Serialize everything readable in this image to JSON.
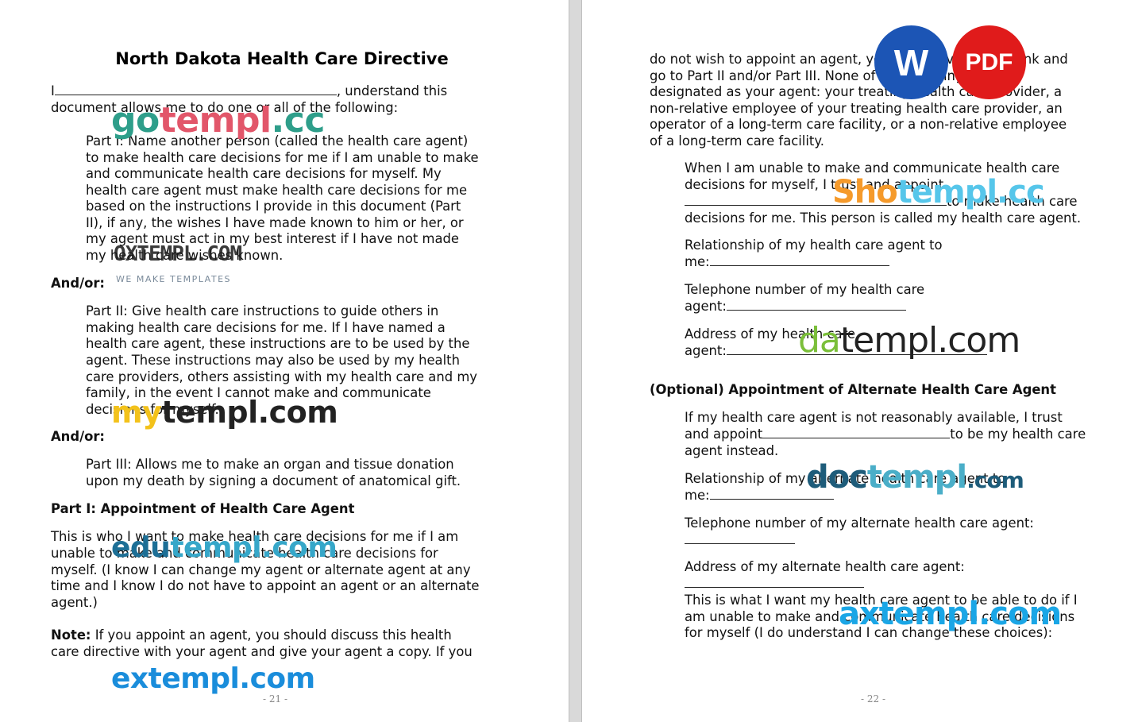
{
  "left_page": {
    "title": "North Dakota Health Care Directive",
    "intro_line1_prefix": "I",
    "intro_line1_suffix": ", understand this",
    "intro_line2": "document allows me to do one or all of the following:",
    "part1_lines": [
      "Part I: Name another person (called the health care agent)",
      "to make health care decisions for me if I am unable to make",
      "and communicate health care decisions for myself. My",
      "health care agent must make health care decisions for me",
      "based on the instructions I provide in this document (Part",
      "II), if any, the wishes I have made known to him or her, or",
      "my agent must act in my best interest if I have not made",
      "my health care wishes known."
    ],
    "and_or_1": "And/or:",
    "part2_lines": [
      "Part II: Give health care instructions to guide others in",
      "making health care decisions for me. If I have named a",
      "health care agent, these instructions are to be used by the",
      "agent. These instructions may also be used by my health",
      "care providers, others assisting with my health care and my",
      "family, in the event I cannot make and communicate",
      "decisions for myself."
    ],
    "and_or_2": "And/or:",
    "part3_lines": [
      "Part III: Allows me to make an organ and tissue donation",
      "upon my death by signing a document of anatomical gift."
    ],
    "heading_part1": "Part I: Appointment of Health Care Agent",
    "agent_lines": [
      "This is who I want to make health care decisions for me if I am",
      "unable to make and communicate health care decisions for",
      "myself. (I know I can change my agent or alternate agent at any",
      "time and I know I do not have to appoint an agent or an alternate",
      "agent.)"
    ],
    "note_label": "Note:",
    "note_line1_rest": " If you appoint an agent, you should discuss this health",
    "note_line2": "care directive with your agent and give your agent a copy. If you",
    "page_number": "- 21 -"
  },
  "right_page": {
    "top_lines": [
      "do not wish to appoint an agent, you may leave Part I blank and",
      "go to Part II and/or Part III. None of the following may be",
      "designated as your agent: your treating health care provider, a",
      "non-relative employee of your treating health care provider, an",
      "operator of a long-term care facility, or a non-relative employee",
      "of a long-term care facility."
    ],
    "appoint_line1": "When I am unable to make and communicate health care",
    "appoint_line2": "decisions for myself, I trust and appoint",
    "appoint_line3_suffix": "to make health care",
    "appoint_line4": "decisions for me. This person is called my health care agent.",
    "relationship_line1": "Relationship of my health care agent to",
    "relationship_line2": "me:",
    "telephone_line1": "Telephone number of my health care",
    "telephone_line2": "agent:",
    "address_line1": "Address of my health care",
    "address_line2": "agent:",
    "heading_optional": "(Optional) Appointment of Alternate Health Care Agent",
    "alt_line1": "If my health care agent is not reasonably available, I trust",
    "alt_line2_prefix": "and appoint",
    "alt_line2_suffix": "to be my health care",
    "alt_line3": "agent instead.",
    "alt_relationship_line1": "Relationship of my alternate health care agent to",
    "alt_relationship_line2": "me:",
    "alt_telephone_line1": "Telephone number of my alternate health care agent:",
    "alt_address_line1": "Address of my alternate health care agent:",
    "powers_lines": [
      "This is what I want my health care agent to be able to do if I",
      "am unable to make and communicate health care decisions",
      "for myself (I do understand I can change these choices):"
    ],
    "page_number": "- 22 -"
  },
  "watermarks": {
    "gotempl_a": "go",
    "gotempl_b": "templ",
    "gotempl_c": ".cc",
    "oxtempl_title": "OXTEMPL.COM",
    "oxtempl_tag": "WE MAKE TEMPLATES",
    "mytempl_a": "my",
    "mytempl_b": "templ.com",
    "edutempl_a": "edu",
    "edutempl_b": "templ.com",
    "extempl_a": "ex",
    "extempl_b": "templ.com",
    "shotempl_a": "Sho",
    "shotempl_b": "templ.cc",
    "datempl_a": "da",
    "datempl_b": "templ.com",
    "doctempl_a": "doc",
    "doctempl_b": "templ",
    "doctempl_c": ".com",
    "axtempl_a": "ax",
    "axtempl_b": "templ.com"
  },
  "badges": {
    "word_label": "W",
    "pdf_label": "PDF",
    "word_color": "#1c55b5",
    "pdf_color": "#e01b1b"
  }
}
